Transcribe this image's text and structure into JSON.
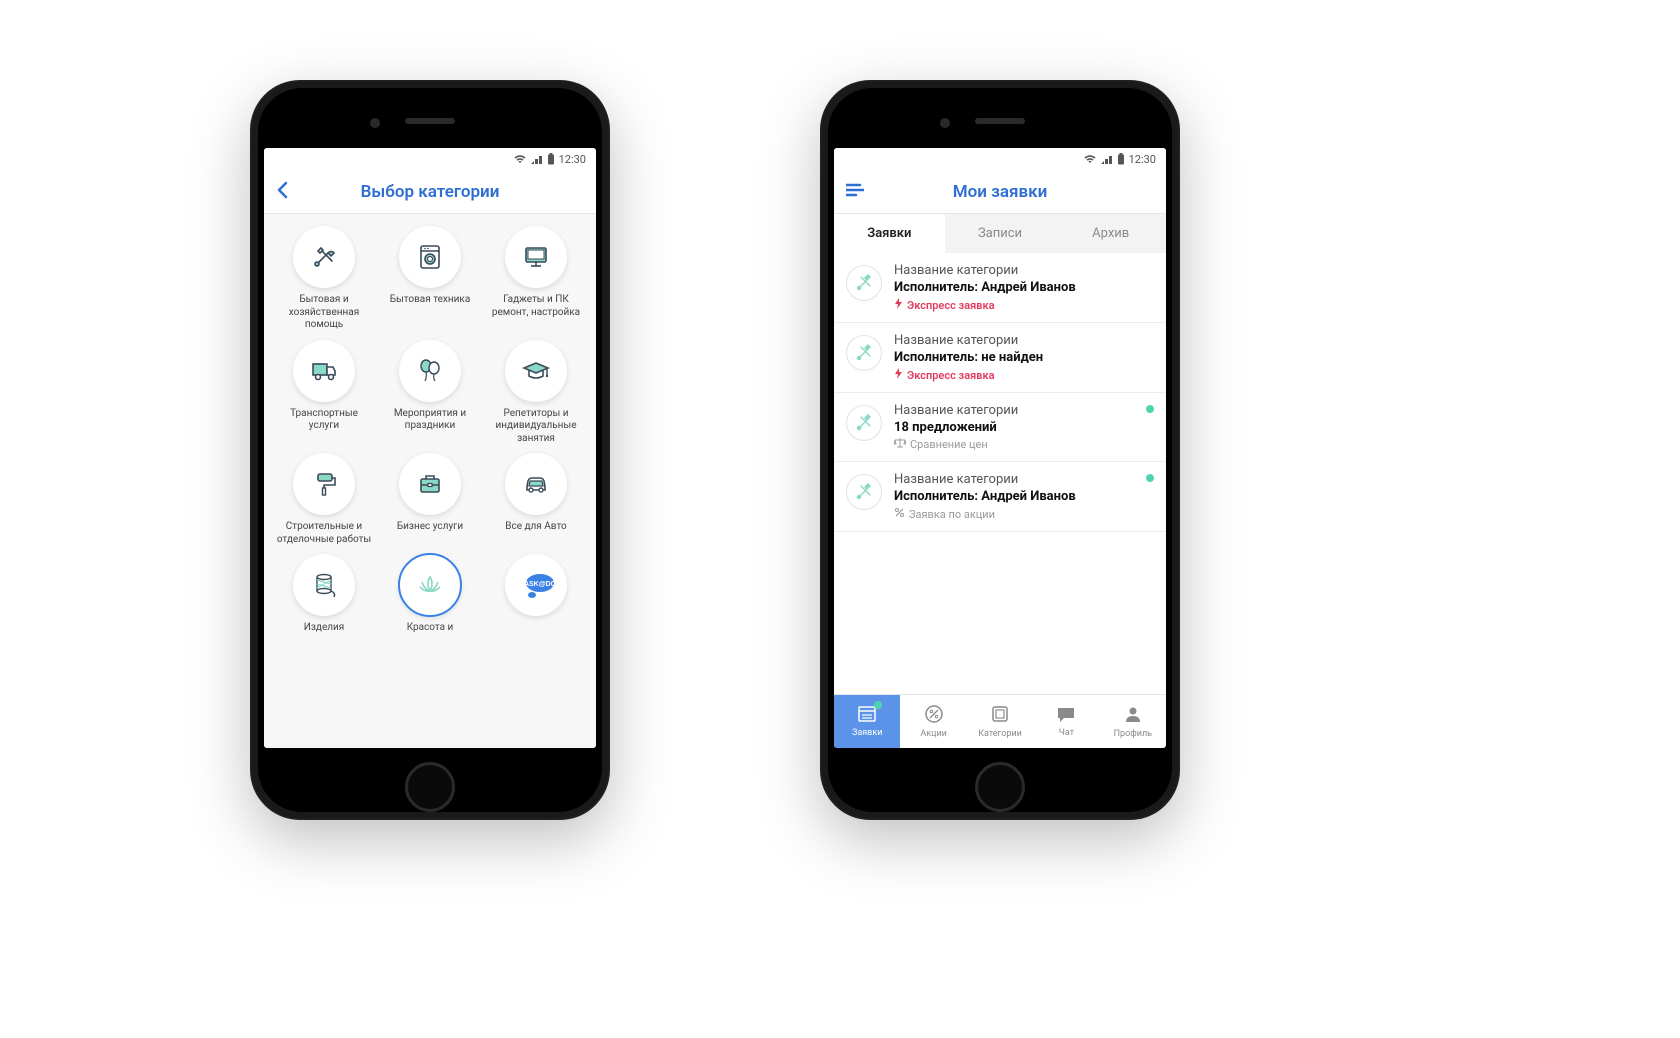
{
  "status_bar": {
    "time": "12:30"
  },
  "left_phone": {
    "header_title": "Выбор категории",
    "categories": [
      {
        "label": "Бытовая и хозяйственная помощь"
      },
      {
        "label": "Бытовая техника"
      },
      {
        "label": "Гаджеты и ПК ремонт, настройка"
      },
      {
        "label": "Транспортные услуги"
      },
      {
        "label": "Мероприятия и праздники"
      },
      {
        "label": "Репетиторы и индивидуальные занятия"
      },
      {
        "label": "Строительные и отделочные работы"
      },
      {
        "label": "Бизнес услуги"
      },
      {
        "label": "Все для Авто"
      },
      {
        "label": "Изделия"
      },
      {
        "label": "Красота и"
      },
      {
        "label": "ASK@DO"
      }
    ]
  },
  "right_phone": {
    "header_title": "Мои заявки",
    "tabs": [
      {
        "label": "Заявки"
      },
      {
        "label": "Записи"
      },
      {
        "label": "Архив"
      }
    ],
    "items": [
      {
        "title": "Название категории",
        "subtitle": "Исполнитель: Андрей Иванов",
        "tag_label": "Экспресс заявка"
      },
      {
        "title": "Название категории",
        "subtitle": "Исполнитель: не найден",
        "tag_label": "Экспресс заявка"
      },
      {
        "title": "Название категории",
        "subtitle": "18 предложений",
        "tag_label": "Сравнение цен"
      },
      {
        "title": "Название категории",
        "subtitle": "Исполнитель: Андрей Иванов",
        "tag_label": "Заявка по акции"
      }
    ],
    "bottom_nav": [
      {
        "label": "Заявки"
      },
      {
        "label": "Акции"
      },
      {
        "label": "Категории"
      },
      {
        "label": "Чат"
      },
      {
        "label": "Профиль"
      }
    ]
  },
  "colors": {
    "primary": "#2f6fd1",
    "accent": "#4fd4b0",
    "danger": "#e23b5a",
    "mint": "#8ad8c5"
  }
}
